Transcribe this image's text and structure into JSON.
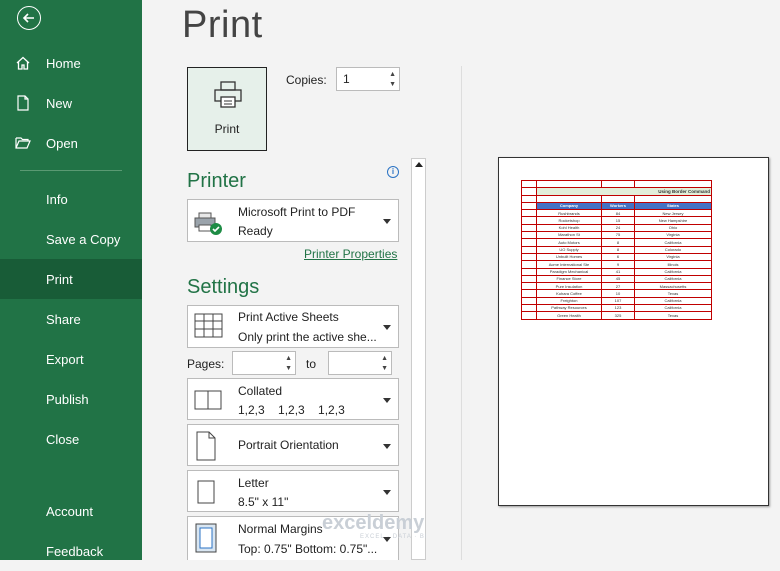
{
  "sidebar": {
    "items": [
      {
        "label": "Home",
        "icon": "home-icon"
      },
      {
        "label": "New",
        "icon": "new-document-icon"
      },
      {
        "label": "Open",
        "icon": "folder-open-icon"
      },
      {
        "label": "Info"
      },
      {
        "label": "Save a Copy"
      },
      {
        "label": "Print",
        "active": true
      },
      {
        "label": "Share"
      },
      {
        "label": "Export"
      },
      {
        "label": "Publish"
      },
      {
        "label": "Close"
      },
      {
        "label": "Account"
      },
      {
        "label": "Feedback"
      }
    ]
  },
  "main": {
    "title": "Print",
    "print_button": "Print",
    "copies_label": "Copies:",
    "copies_value": "1"
  },
  "printer": {
    "heading": "Printer",
    "name": "Microsoft Print to PDF",
    "status": "Ready",
    "properties_link": "Printer Properties"
  },
  "settings": {
    "heading": "Settings",
    "scope": {
      "title": "Print Active Sheets",
      "subtitle": "Only print the active she..."
    },
    "pages_label": "Pages:",
    "to_label": "to",
    "collation": {
      "title": "Collated",
      "subtitle": "1,2,3    1,2,3    1,2,3"
    },
    "orientation": {
      "title": "Portrait Orientation"
    },
    "paper": {
      "title": "Letter",
      "subtitle": "8.5\" x 11\""
    },
    "margins": {
      "title": "Normal Margins",
      "subtitle": "Top: 0.75\" Bottom: 0.75\"..."
    }
  },
  "preview": {
    "title": "Using Border Command",
    "headers": [
      "Company",
      "Workers",
      "States"
    ],
    "rows": [
      [
        "Rushbrands",
        "84",
        "New Jersey"
      ],
      [
        "Rocketshop",
        "15",
        "New Hampshire"
      ],
      [
        "Kohl Health",
        "24",
        "Ohio"
      ],
      [
        "Marathon St",
        "75",
        "Virginia"
      ],
      [
        "Auto Motors",
        "8",
        "California"
      ],
      [
        "UO Supply",
        "8",
        "Colorado"
      ],
      [
        "Unbuilt Homes",
        "6",
        "Virginia"
      ],
      [
        "Acme International Ste",
        "9",
        "Illinois"
      ],
      [
        "Paradigm Mechanical",
        "41",
        "California"
      ],
      [
        "Finance Store",
        "45",
        "California"
      ],
      [
        "Pure Insulation",
        "27",
        "Massachusetts"
      ],
      [
        "Kuhara Coffee",
        "10",
        "Texas"
      ],
      [
        "Freighton",
        "107",
        "California"
      ],
      [
        "Pathway Resources",
        "123",
        "California"
      ],
      [
        "Green Health",
        "325",
        "Texas"
      ]
    ]
  },
  "watermark": {
    "name": "exceldemy",
    "tagline": "EXCEL · DATA · BI"
  },
  "colors": {
    "accent": "#217346",
    "accent_dark": "#185c37",
    "table_header": "#4472c4",
    "table_border": "#c00000"
  }
}
